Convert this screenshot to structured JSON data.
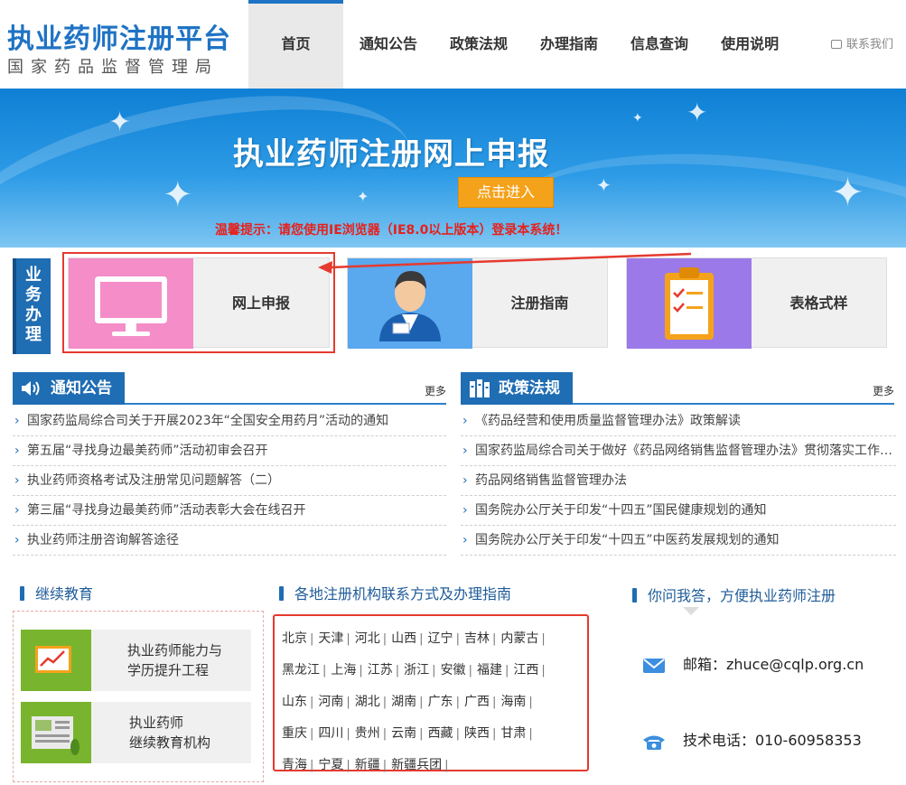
{
  "header": {
    "title": "执业药师注册平台",
    "subtitle": "国家药品监督管理局",
    "nav": [
      "首页",
      "通知公告",
      "政策法规",
      "办理指南",
      "信息查询",
      "使用说明"
    ],
    "contact_link": "联系我们"
  },
  "banner": {
    "title": "执业药师注册网上申报",
    "enter_button": "点击进入",
    "tip": "温馨提示：请您使用IE浏览器（IE8.0以上版本）登录本系统！"
  },
  "business": {
    "label": "业务办理",
    "cards": [
      "网上申报",
      "注册指南",
      "表格式样"
    ]
  },
  "notices": {
    "title": "通知公告",
    "more": "更多",
    "items": [
      "国家药监局综合司关于开展2023年“全国安全用药月”活动的通知",
      "第五届“寻找身边最美药师”活动初审会召开",
      "执业药师资格考试及注册常见问题解答（二）",
      "第三届“寻找身边最美药师”活动表彰大会在线召开",
      "执业药师注册咨询解答途径"
    ]
  },
  "policies": {
    "title": "政策法规",
    "more": "更多",
    "items": [
      "《药品经营和使用质量监督管理办法》政策解读",
      "国家药监局综合司关于做好《药品网络销售监督管理办法》贯彻落实工作的通知",
      "药品网络销售监督管理办法",
      "国务院办公厅关于印发“十四五”国民健康规划的通知",
      "国务院办公厅关于印发“十四五”中医药发展规划的通知"
    ]
  },
  "education": {
    "title": "继续教育",
    "items": [
      {
        "line1": "执业药师能力与",
        "line2": "学历提升工程"
      },
      {
        "line1": "执业药师",
        "line2": "继续教育机构"
      }
    ]
  },
  "regions": {
    "title": "各地注册机构联系方式及办理指南",
    "separator": "|",
    "rows": [
      [
        "北京",
        "天津",
        "河北",
        "山西",
        "辽宁",
        "吉林",
        "内蒙古"
      ],
      [
        "黑龙江",
        "上海",
        "江苏",
        "浙江",
        "安徽",
        "福建",
        "江西"
      ],
      [
        "山东",
        "河南",
        "湖北",
        "湖南",
        "广东",
        "广西",
        "海南"
      ],
      [
        "重庆",
        "四川",
        "贵州",
        "云南",
        "西藏",
        "陕西",
        "甘肃"
      ],
      [
        "青海",
        "宁夏",
        "新疆",
        "新疆兵团"
      ]
    ]
  },
  "qa": {
    "title": "你问我答，方便执业药师注册",
    "email": "邮箱：zhuce@cqlp.org.cn",
    "phone": "技术电话：010-60958353"
  },
  "colors": {
    "brand_blue": "#1f73c4",
    "accent_orange": "#f5a21b",
    "highlight_red": "#e53a2f"
  }
}
